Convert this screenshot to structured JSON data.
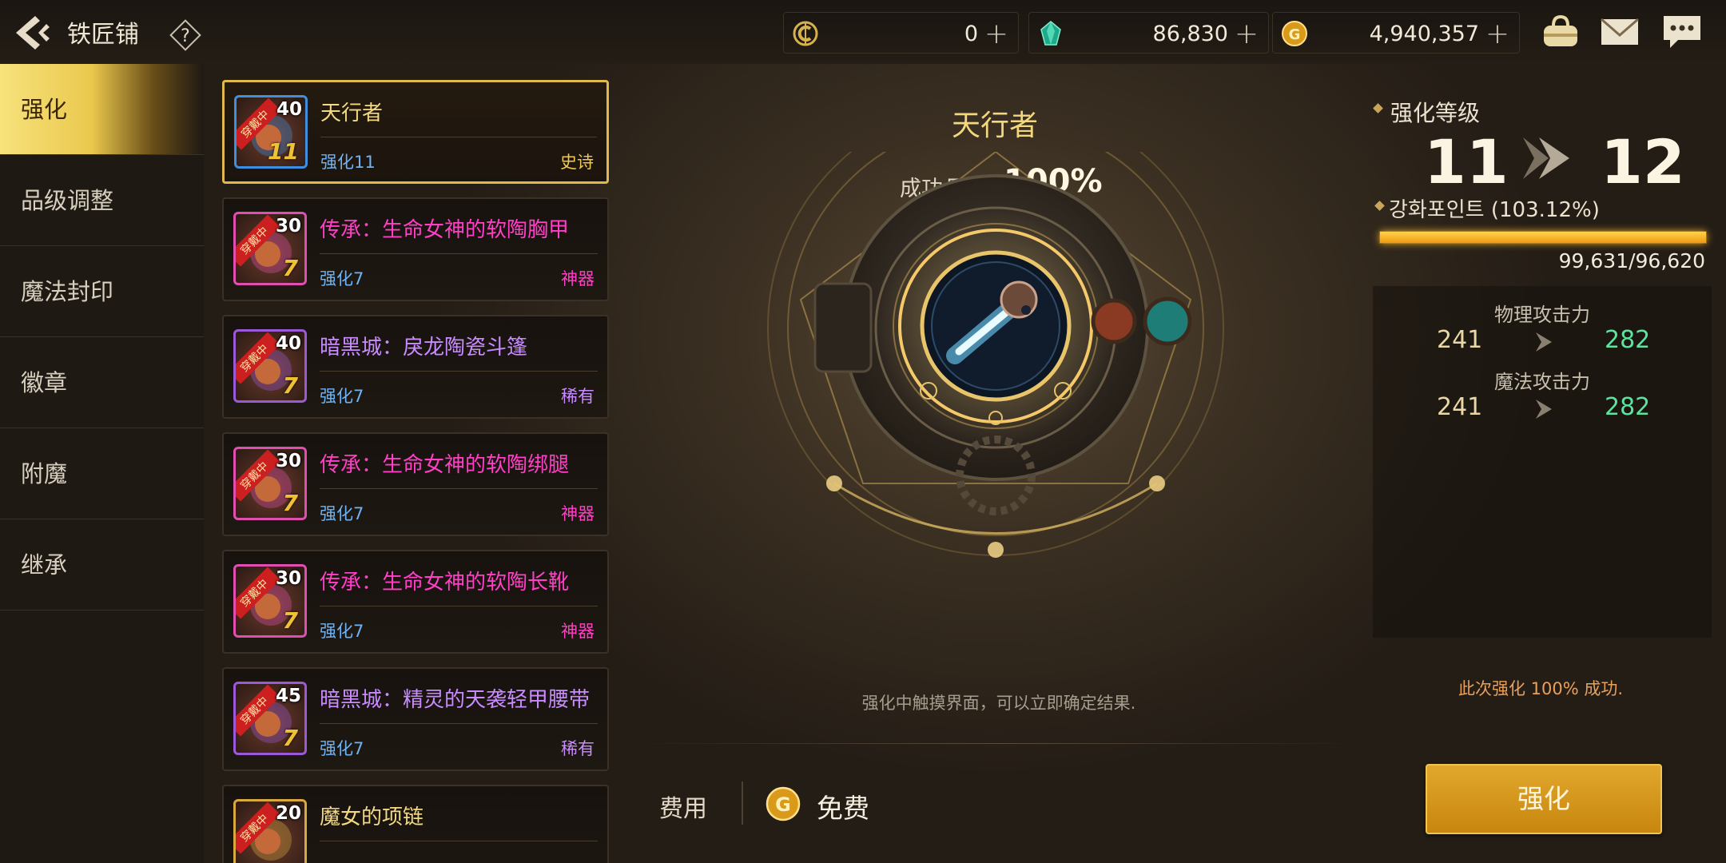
{
  "header": {
    "title": "铁匠铺",
    "currencies": [
      {
        "icon": "c-token-icon",
        "value": "0"
      },
      {
        "icon": "green-crystal-icon",
        "value": "86,830"
      },
      {
        "icon": "gold-coin-icon",
        "value": "4,940,357"
      }
    ],
    "plus_symbol": "+",
    "help_symbol": "?"
  },
  "nav": {
    "items": [
      {
        "label": "强化",
        "active": true
      },
      {
        "label": "品级调整",
        "active": false
      },
      {
        "label": "魔法封印",
        "active": false
      },
      {
        "label": "徽章",
        "active": false
      },
      {
        "label": "附魔",
        "active": false
      },
      {
        "label": "继承",
        "active": false
      }
    ]
  },
  "items": [
    {
      "level": "40",
      "wear": "穿戴中",
      "enh_badge": "11",
      "name": "天行者",
      "enh": "强化11",
      "grade": "史诗",
      "name_color": "#f3d982",
      "grade_color": "#f2c94c",
      "frame": "#3f8fe0",
      "selected": true
    },
    {
      "level": "30",
      "wear": "穿戴中",
      "enh_badge": "7",
      "name": "传承：生命女神的软陶胸甲",
      "enh": "强化7",
      "grade": "神器",
      "name_color": "#ff3fc6",
      "grade_color": "#ff3fc6",
      "frame": "#e04fb0",
      "selected": false
    },
    {
      "level": "40",
      "wear": "穿戴中",
      "enh_badge": "7",
      "name": "暗黑城：戾龙陶瓷斗篷",
      "enh": "强化7",
      "grade": "稀有",
      "name_color": "#c98cff",
      "grade_color": "#c98cff",
      "frame": "#9b59d8",
      "selected": false
    },
    {
      "level": "30",
      "wear": "穿戴中",
      "enh_badge": "7",
      "name": "传承：生命女神的软陶绑腿",
      "enh": "强化7",
      "grade": "神器",
      "name_color": "#ff3fc6",
      "grade_color": "#ff3fc6",
      "frame": "#e04fb0",
      "selected": false
    },
    {
      "level": "30",
      "wear": "穿戴中",
      "enh_badge": "7",
      "name": "传承：生命女神的软陶长靴",
      "enh": "强化7",
      "grade": "神器",
      "name_color": "#ff3fc6",
      "grade_color": "#ff3fc6",
      "frame": "#e04fb0",
      "selected": false
    },
    {
      "level": "45",
      "wear": "穿戴中",
      "enh_badge": "7",
      "name": "暗黑城：精灵的天袭轻甲腰带",
      "enh": "强化7",
      "grade": "稀有",
      "name_color": "#c98cff",
      "grade_color": "#c98cff",
      "frame": "#9b59d8",
      "selected": false
    },
    {
      "level": "20",
      "wear": "穿戴中",
      "enh_badge": "",
      "name": "魔女的项链",
      "enh": "",
      "grade": "",
      "name_color": "#f3d982",
      "grade_color": "#f2c94c",
      "frame": "#d8a93f",
      "selected": false
    }
  ],
  "center": {
    "item_name": "天行者",
    "rate_label": "成功几率",
    "rate_value": "100%",
    "hint": "强化中触摸界面，可以立即确定结果.",
    "cost_label": "费用",
    "cost_value": "免费"
  },
  "right": {
    "level_label": "强化等级",
    "level_from": "11",
    "level_to": "12",
    "points_label": "강화포인트 (103.12%)",
    "points_fill": 1.0,
    "points_text": "99,631/96,620",
    "stats": [
      {
        "name": "物理攻击力",
        "from": "241",
        "to": "282"
      },
      {
        "name": "魔法攻击力",
        "from": "241",
        "to": "282"
      }
    ],
    "success_note": "此次强化 100% 成功.",
    "button_label": "强化"
  }
}
